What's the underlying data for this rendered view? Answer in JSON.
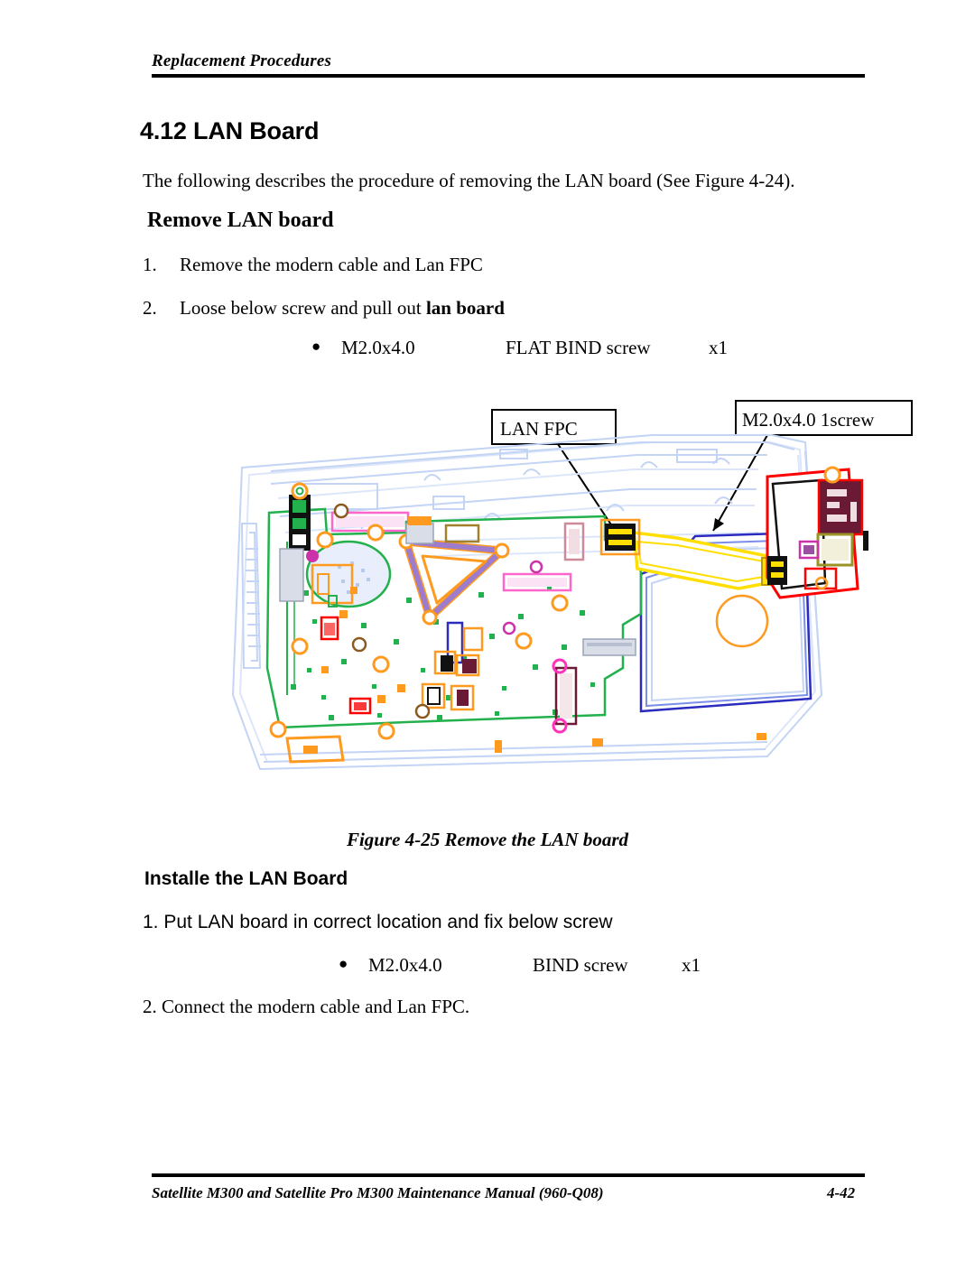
{
  "header": {
    "running_title": "Replacement Procedures"
  },
  "section": {
    "number_title": "4.12 LAN Board",
    "intro": "The following describes the procedure of removing the LAN board (See Figure 4-24)."
  },
  "remove": {
    "heading": "Remove LAN board",
    "steps": [
      {
        "num": "1.",
        "text": "Remove the modern cable and Lan FPC"
      },
      {
        "num": "2.",
        "text_before": "Loose below screw and pull out ",
        "text_bold": "lan board"
      }
    ],
    "screw": {
      "bullet": "●",
      "size": "M2.0x4.0",
      "kind": "FLAT BIND screw",
      "qty": "x1"
    }
  },
  "install": {
    "heading": "Installe the LAN Board",
    "step_1": "1. Put LAN board in correct location and fix below screw",
    "step_2": "2. Connect the modern cable and Lan FPC.",
    "screw": {
      "bullet": "●",
      "size": "M2.0x4.0",
      "kind": "BIND screw",
      "qty": "x1"
    }
  },
  "figure": {
    "caption": "Figure 4-25  Remove the LAN board",
    "callouts": [
      {
        "id": "lan-fpc",
        "label": "LAN FPC"
      },
      {
        "id": "screw-spec",
        "label": "M2.0x4.0   1screw"
      }
    ],
    "colors": {
      "chassis": "#c3d4f4",
      "chassis_light": "#dce6fa",
      "pcb_outline": "#22b14c",
      "fpc_cable": "#ffde00",
      "lan_board_outline": "#ff0000",
      "rj45_connector": "#6b1a35",
      "heatsink": "#9d7ccd",
      "screw_point": "#ff9a20",
      "bay_outline": "#2b2bbf",
      "connector_black": "#111111",
      "accent_pink": "#ff66cc",
      "accent_olive": "#9a9326",
      "accent_magenta": "#cc33aa"
    }
  },
  "footer": {
    "manual": "Satellite M300 and Satellite Pro M300 Maintenance Manual (960-Q08)",
    "page": "4-42"
  }
}
